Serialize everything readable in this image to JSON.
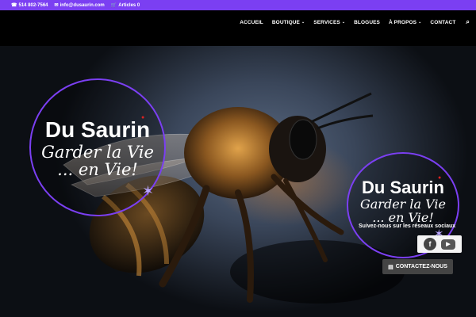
{
  "topbar": {
    "phone": "514 802-7564",
    "email": "info@dusaurin.com",
    "cart": "Articles 0"
  },
  "nav": {
    "items": [
      {
        "label": "ACCUEIL",
        "dropdown": false
      },
      {
        "label": "BOUTIQUE",
        "dropdown": true
      },
      {
        "label": "SERVICES",
        "dropdown": true
      },
      {
        "label": "BLOGUES",
        "dropdown": false
      },
      {
        "label": "À PROPOS",
        "dropdown": true
      },
      {
        "label": "CONTACT",
        "dropdown": false
      }
    ]
  },
  "logo": {
    "brand": "Du Saurin",
    "motto_line1": "Garder la Vie",
    "motto_line2": "... en Vie!"
  },
  "social": {
    "title": "Suivez-nous sur les réseaux sociaux",
    "facebook_glyph": "f",
    "youtube_glyph": "▶"
  },
  "contact_button": {
    "label": "CONTACTEZ-NOUS"
  },
  "colors": {
    "accent": "#7b3ff2",
    "header_bg": "#000000",
    "button_bg": "#444444"
  }
}
